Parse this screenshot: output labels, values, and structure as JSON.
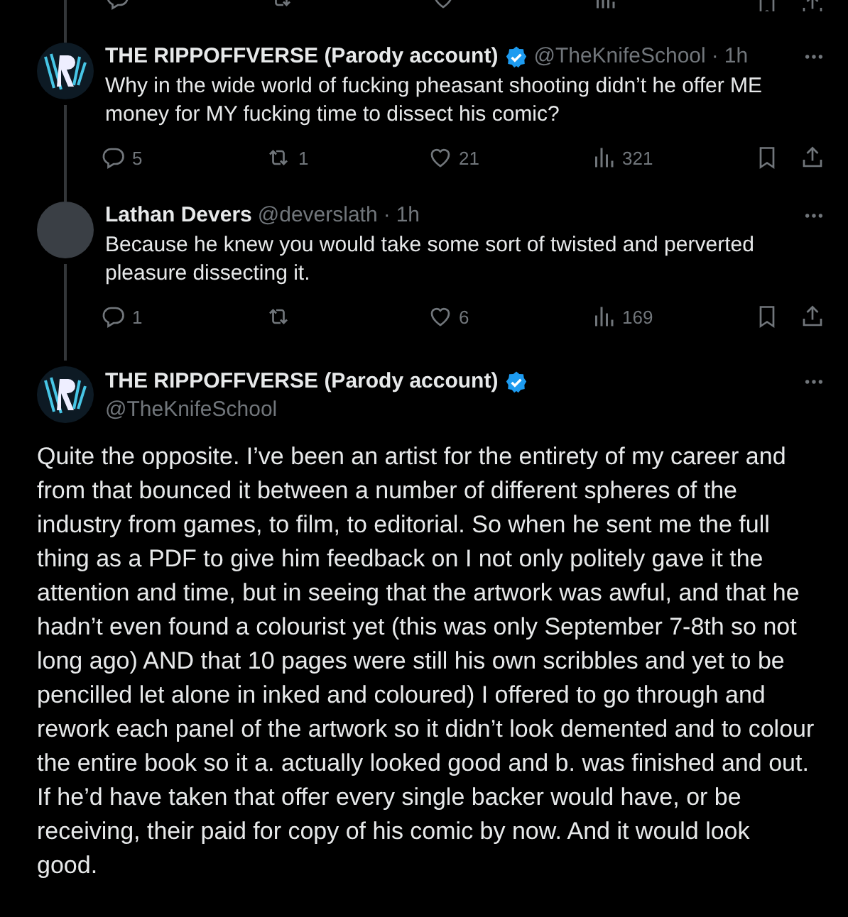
{
  "replies": [
    {
      "author": "THE RIPPOFFVERSE (Parody account)",
      "verified": true,
      "handle": "@TheKnifeSchool",
      "separator": "·",
      "time": "1h",
      "avatar": {
        "kind": "logo"
      },
      "text": "Why in the wide world of fucking pheasant shooting  didn’t he offer ME money for MY fucking time to dissect his comic?",
      "stats": {
        "replies": "5",
        "reposts": "1",
        "likes": "21",
        "views": "321"
      }
    },
    {
      "author": "Lathan Devers",
      "verified": false,
      "handle": "@deverslath",
      "separator": "·",
      "time": "1h",
      "avatar": {
        "kind": "photo"
      },
      "text": "Because he knew you would take some sort of twisted and perverted pleasure dissecting it.",
      "stats": {
        "replies": "1",
        "likes": "6",
        "views": "169"
      }
    }
  ],
  "main_tweet": {
    "author": "THE RIPPOFFVERSE (Parody account)",
    "verified": true,
    "handle": "@TheKnifeSchool",
    "avatar": {
      "kind": "logo"
    },
    "text": "Quite the opposite. I’ve been an artist for the entirety of my career and from that bounced it between a number of different spheres of the industry from games, to film, to editorial. So when he sent me the full thing as a PDF to give him feedback on I not only politely gave it the attention and time, but in seeing that the artwork was awful, and that he hadn’t even found a colourist yet (this was only September 7-8th so not long ago) AND that 10 pages were still his own scribbles and yet to be pencilled let alone in inked and coloured) I offered to go through and rework each panel of the artwork so it didn’t look demented and to colour the entire book so it a. actually looked good and b. was finished and out. If he’d have taken that offer every single backer would have, or be receiving, their paid for copy of his comic by now. And it would look good."
  }
}
